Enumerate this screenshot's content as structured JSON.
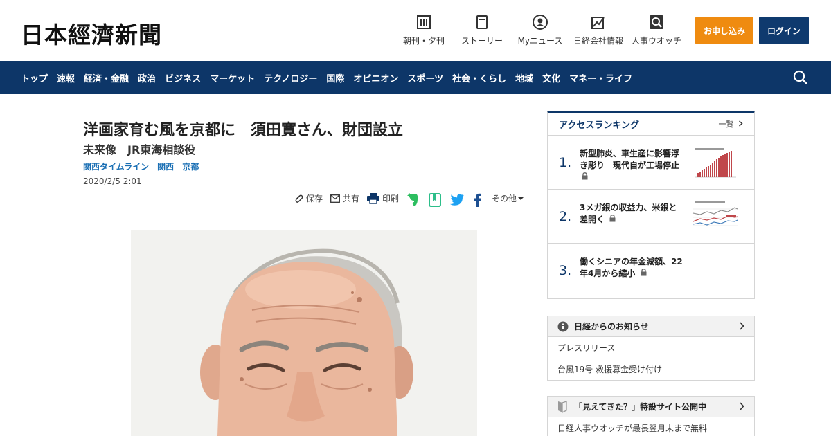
{
  "header": {
    "logo": "日本經濟新聞",
    "nav": [
      {
        "label": "朝刊・夕刊",
        "icon": "newspaper-icon"
      },
      {
        "label": "ストーリー",
        "icon": "book-icon"
      },
      {
        "label": "Myニュース",
        "icon": "user-icon"
      },
      {
        "label": "日経会社情報",
        "icon": "chart-icon"
      },
      {
        "label": "人事ウオッチ",
        "icon": "search-person-icon"
      }
    ],
    "apply_label": "お申し込み",
    "login_label": "ログイン"
  },
  "global_nav": {
    "items": [
      "トップ",
      "速報",
      "経済・金融",
      "政治",
      "ビジネス",
      "マーケット",
      "テクノロジー",
      "国際",
      "オピニオン",
      "スポーツ",
      "社会・くらし",
      "地域",
      "文化",
      "マネー・ライフ"
    ]
  },
  "article": {
    "title": "洋画家育む風を京都に　須田寛さん、財団設立",
    "subtitle": "未来像　JR東海相談役",
    "tags": [
      "関西タイムライン",
      "関西",
      "京都"
    ],
    "date": "2020/2/5 2:01",
    "share": {
      "save": "保存",
      "share": "共有",
      "print": "印刷",
      "other": "その他"
    }
  },
  "ranking": {
    "title": "アクセスランキング",
    "more": "一覧",
    "items": [
      {
        "num": "1.",
        "text": "新型肺炎、車生産に影響浮き彫り　現代自が工場停止"
      },
      {
        "num": "2.",
        "text": "3メガ銀の収益力、米銀と差開く"
      },
      {
        "num": "3.",
        "text": "働くシニアの年金減額、22年4月から縮小"
      }
    ]
  },
  "notice": {
    "title": "日経からのお知らせ",
    "rows": [
      "プレスリリース",
      "台風19号 救援募金受け付け"
    ]
  },
  "promo": {
    "title": "「見えてきた？」特設サイト公開中",
    "rows": [
      "日経人事ウオッチが最長翌月末まで無料"
    ]
  },
  "colors": {
    "navy": "#0d3668",
    "orange": "#ef8b10",
    "link": "#1a6fb4"
  }
}
